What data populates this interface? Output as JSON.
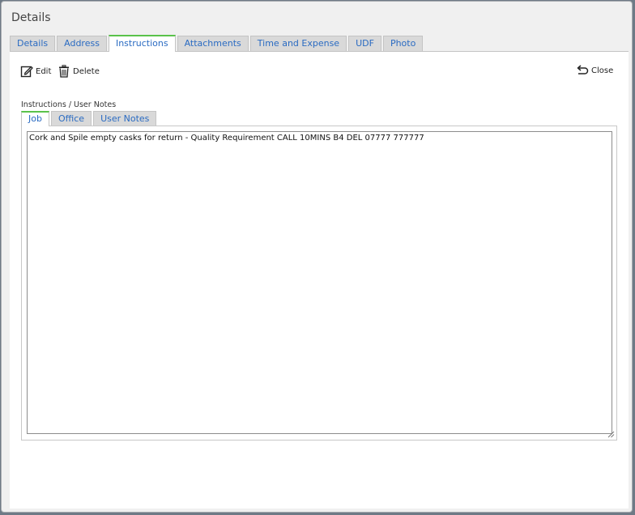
{
  "dialog": {
    "title": "Details"
  },
  "top_tabs": [
    {
      "label": "Details",
      "active": false
    },
    {
      "label": "Address",
      "active": false
    },
    {
      "label": "Instructions",
      "active": true
    },
    {
      "label": "Attachments",
      "active": false
    },
    {
      "label": "Time and Expense",
      "active": false
    },
    {
      "label": "UDF",
      "active": false
    },
    {
      "label": "Photo",
      "active": false
    }
  ],
  "toolbar": {
    "edit_label": "Edit",
    "delete_label": "Delete",
    "close_label": "Close"
  },
  "section": {
    "label": "Instructions / User Notes"
  },
  "sub_tabs": [
    {
      "label": "Job",
      "active": true
    },
    {
      "label": "Office",
      "active": false
    },
    {
      "label": "User Notes",
      "active": false
    }
  ],
  "notes": {
    "value": "Cork and Spile empty casks for return - Quality Requirement CALL 10MINS B4 DEL 07777 777777"
  },
  "colors": {
    "tab_link": "#2a6bc2",
    "active_tab_accent": "#5ac24a",
    "dialog_bg": "#f0f0f0"
  },
  "icons": {
    "edit": "edit-icon",
    "delete": "trash-icon",
    "close": "undo-arrow-icon"
  }
}
